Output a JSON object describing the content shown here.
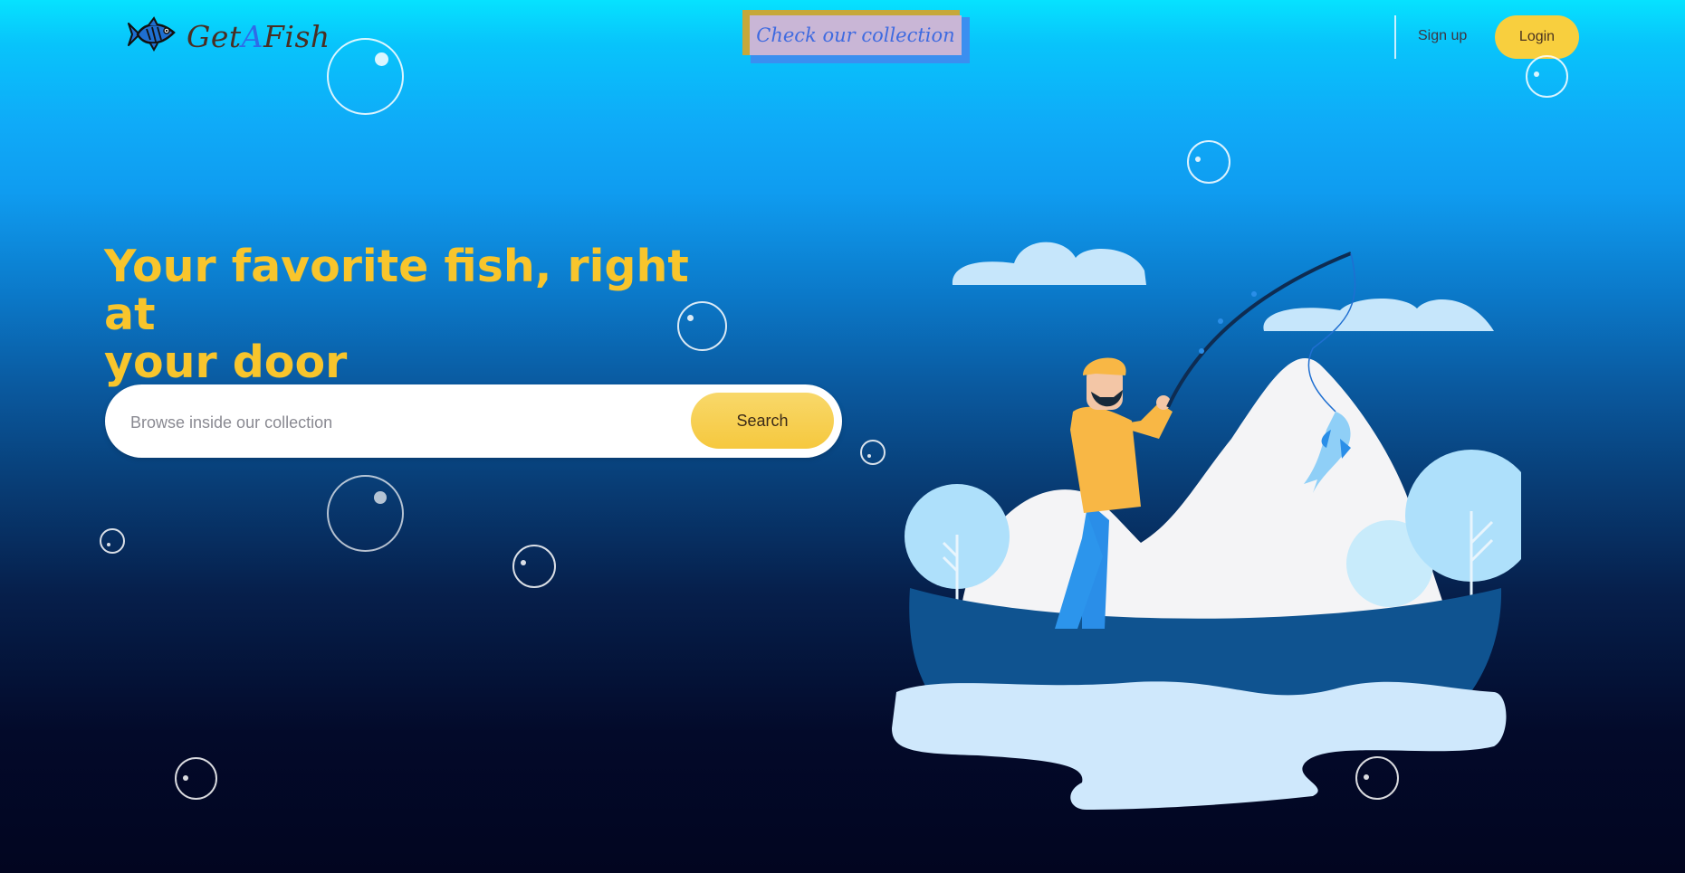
{
  "header": {
    "logo": {
      "prefix": "Get",
      "accent": "A",
      "suffix": "Fish",
      "icon": "fish-icon"
    },
    "collection_button": "Check our collection",
    "signup": "Sign up",
    "login": "Login"
  },
  "hero": {
    "headline_line1": "Your favorite fish, right at",
    "headline_line2": "your door",
    "search": {
      "placeholder": "Browse inside our collection",
      "value": "",
      "button": "Search"
    },
    "illustration": "fisherman-on-boat-illustration"
  },
  "colors": {
    "accent_yellow": "#f8c52c",
    "button_yellow": "#f8cf3e",
    "link_blue": "#3e6ae0",
    "sky_top": "#06e2ff",
    "deep_navy": "#020520"
  }
}
